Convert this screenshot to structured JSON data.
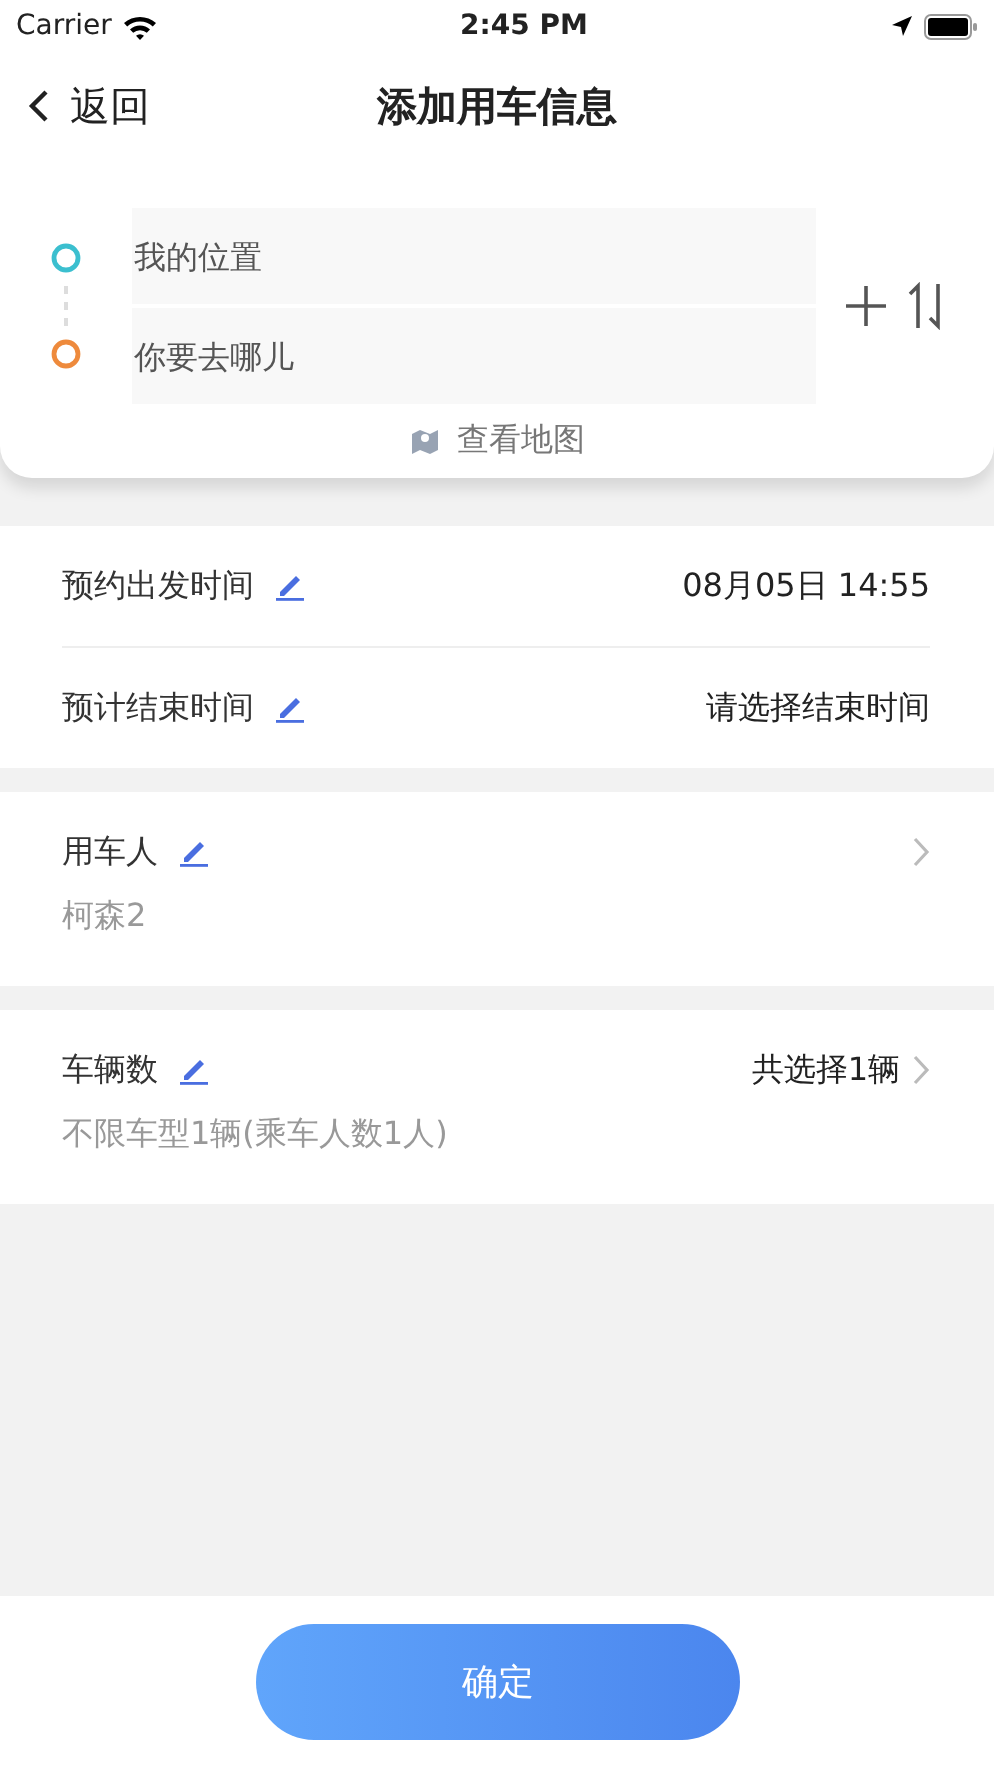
{
  "status_bar": {
    "carrier": "Carrier",
    "time": "2:45 PM"
  },
  "nav": {
    "back": "返回",
    "title": "添加用车信息"
  },
  "route": {
    "stops": [
      {
        "color": "#3bbfcf",
        "placeholder": "我的位置"
      },
      {
        "color": "#ee8a3c",
        "placeholder": "你要去哪儿"
      }
    ],
    "map_link": "查看地图"
  },
  "sections": [
    {
      "rows": [
        {
          "label": "预约出发时间",
          "value": "08月05日 14:55",
          "chevron": false
        },
        {
          "label": "预计结束时间",
          "value": "请选择结束时间",
          "chevron": false
        }
      ]
    },
    {
      "rows": [
        {
          "label": "用车人",
          "chevron": true,
          "detail": "柯森2"
        }
      ]
    },
    {
      "rows": [
        {
          "label": "车辆数",
          "value": "共选择1辆",
          "chevron": true,
          "detail": "不限车型1辆(乘车人数1人)"
        }
      ]
    }
  ],
  "confirm_button": "确定"
}
